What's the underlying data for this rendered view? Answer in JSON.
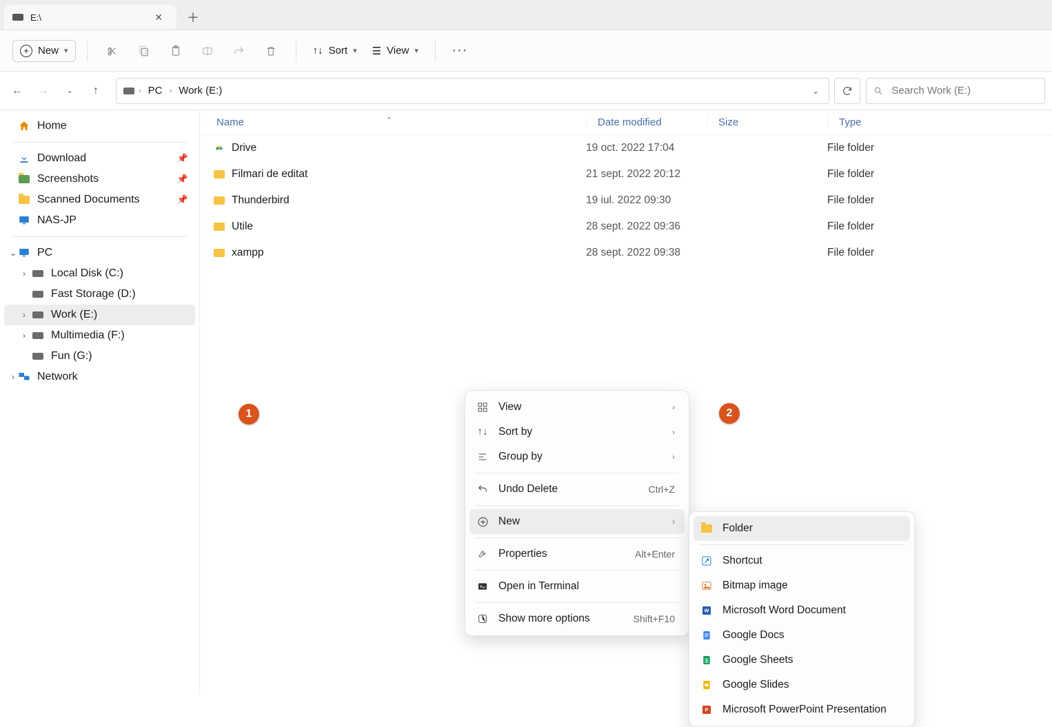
{
  "tab": {
    "title": "E:\\"
  },
  "toolbar": {
    "new_label": "New",
    "sort_label": "Sort",
    "view_label": "View"
  },
  "nav": {
    "crumbs": [
      "PC",
      "Work (E:)"
    ]
  },
  "search": {
    "placeholder": "Search Work (E:)"
  },
  "sidebar": {
    "home": "Home",
    "quick": [
      {
        "label": "Download"
      },
      {
        "label": "Screenshots"
      },
      {
        "label": "Scanned Documents"
      },
      {
        "label": "NAS-JP"
      }
    ],
    "pc": "PC",
    "drives": [
      {
        "label": "Local Disk (C:)"
      },
      {
        "label": "Fast Storage (D:)"
      },
      {
        "label": "Work (E:)",
        "active": true
      },
      {
        "label": "Multimedia (F:)"
      },
      {
        "label": "Fun (G:)"
      }
    ],
    "network": "Network"
  },
  "columns": {
    "name": "Name",
    "date": "Date modified",
    "size": "Size",
    "type": "Type"
  },
  "files": [
    {
      "name": "Drive",
      "date": "19 oct. 2022 17:04",
      "type": "File folder",
      "icon": "drive"
    },
    {
      "name": "Filmari de editat",
      "date": "21 sept. 2022 20:12",
      "type": "File folder",
      "icon": "folder"
    },
    {
      "name": "Thunderbird",
      "date": "19 iul. 2022 09:30",
      "type": "File folder",
      "icon": "folder"
    },
    {
      "name": "Utile",
      "date": "28 sept. 2022 09:36",
      "type": "File folder",
      "icon": "folder"
    },
    {
      "name": "xampp",
      "date": "28 sept. 2022 09:38",
      "type": "File folder",
      "icon": "folder"
    }
  ],
  "context_menu": {
    "view": "View",
    "sort_by": "Sort by",
    "group_by": "Group by",
    "undo": "Undo Delete",
    "undo_sc": "Ctrl+Z",
    "new": "New",
    "properties": "Properties",
    "properties_sc": "Alt+Enter",
    "terminal": "Open in Terminal",
    "more": "Show more options",
    "more_sc": "Shift+F10"
  },
  "submenu": {
    "folder": "Folder",
    "shortcut": "Shortcut",
    "bitmap": "Bitmap image",
    "word": "Microsoft Word Document",
    "gdocs": "Google Docs",
    "gsheets": "Google Sheets",
    "gslides": "Google Slides",
    "ppt": "Microsoft PowerPoint Presentation"
  },
  "badges": {
    "b1": "1",
    "b2": "2"
  }
}
